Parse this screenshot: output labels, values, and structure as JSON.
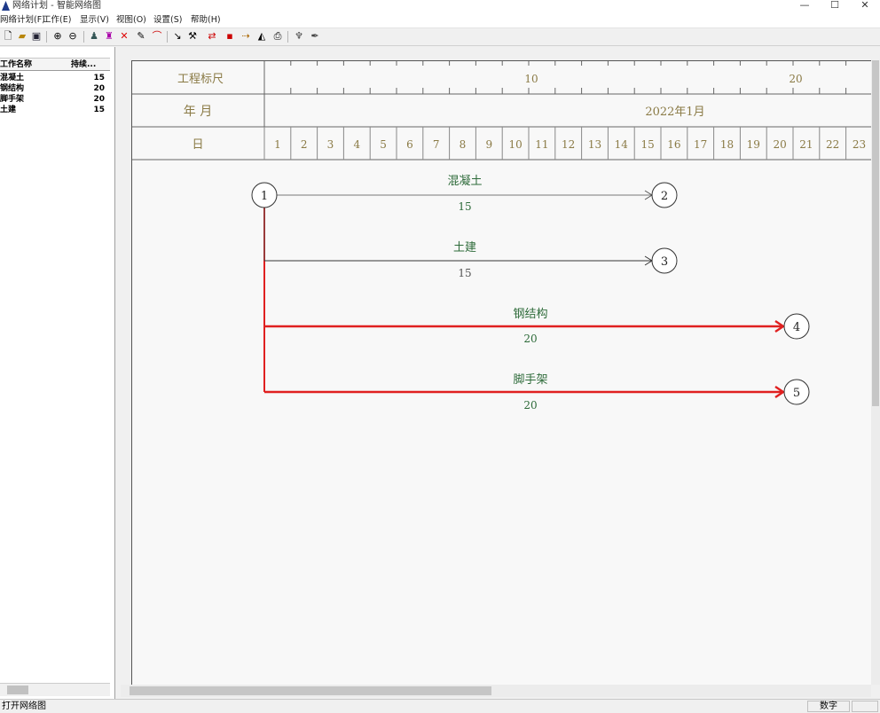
{
  "window": {
    "title": "网络计划 - 智能网络图",
    "minimize": "—",
    "maximize": "☐",
    "close": "✕"
  },
  "menu": {
    "items": [
      {
        "label": "网络计划(F)"
      },
      {
        "label": "工作(E)"
      },
      {
        "label": "显示(V)"
      },
      {
        "label": "视图(O)"
      },
      {
        "label": "设置(S)"
      },
      {
        "label": "帮助(H)"
      }
    ]
  },
  "toolbar": {
    "icons": [
      "new-file-icon",
      "open-folder-icon",
      "save-icon",
      "zoom-in-icon",
      "zoom-out-icon",
      "person-icon",
      "bottle-icon",
      "delete-icon",
      "pen-icon",
      "curve-icon",
      "pointer-icon",
      "hammer-icon",
      "link-icon",
      "node-icon",
      "arrow-icon",
      "chart-icon",
      "print-icon",
      "tool-icon",
      "brush-icon"
    ]
  },
  "task_list": {
    "headers": {
      "name": "工作名称",
      "duration": "持续..."
    },
    "rows": [
      {
        "name": "混凝土",
        "duration": "15"
      },
      {
        "name": "钢结构",
        "duration": "20"
      },
      {
        "name": "脚手架",
        "duration": "20"
      },
      {
        "name": "土建",
        "duration": "15"
      }
    ]
  },
  "chart": {
    "ruler_label": "工程标尺",
    "ruler_marks": [
      "10",
      "20"
    ],
    "year_month_label": "年 月",
    "year_month_value": "2022年1月",
    "day_label": "日",
    "days": [
      "1",
      "2",
      "3",
      "4",
      "5",
      "6",
      "7",
      "8",
      "9",
      "10",
      "11",
      "12",
      "13",
      "14",
      "15",
      "16",
      "17",
      "18",
      "19",
      "20",
      "21",
      "22",
      "23"
    ],
    "nodes": [
      "1",
      "2",
      "3",
      "4",
      "5"
    ],
    "activities": [
      {
        "name": "混凝土",
        "duration": "15",
        "from": "1",
        "to": "2",
        "critical": false
      },
      {
        "name": "土建",
        "duration": "15",
        "from": "1",
        "to": "3",
        "critical": false
      },
      {
        "name": "钢结构",
        "duration": "20",
        "from": "1",
        "to": "4",
        "critical": true
      },
      {
        "name": "脚手架",
        "duration": "20",
        "from": "1",
        "to": "5",
        "critical": true
      }
    ],
    "colors": {
      "critical": "#e02020",
      "normal": "#555555",
      "label": "#2e6b3a",
      "header": "#8a7a45"
    }
  },
  "status": {
    "text": "打开网络图",
    "pane": "数字"
  }
}
